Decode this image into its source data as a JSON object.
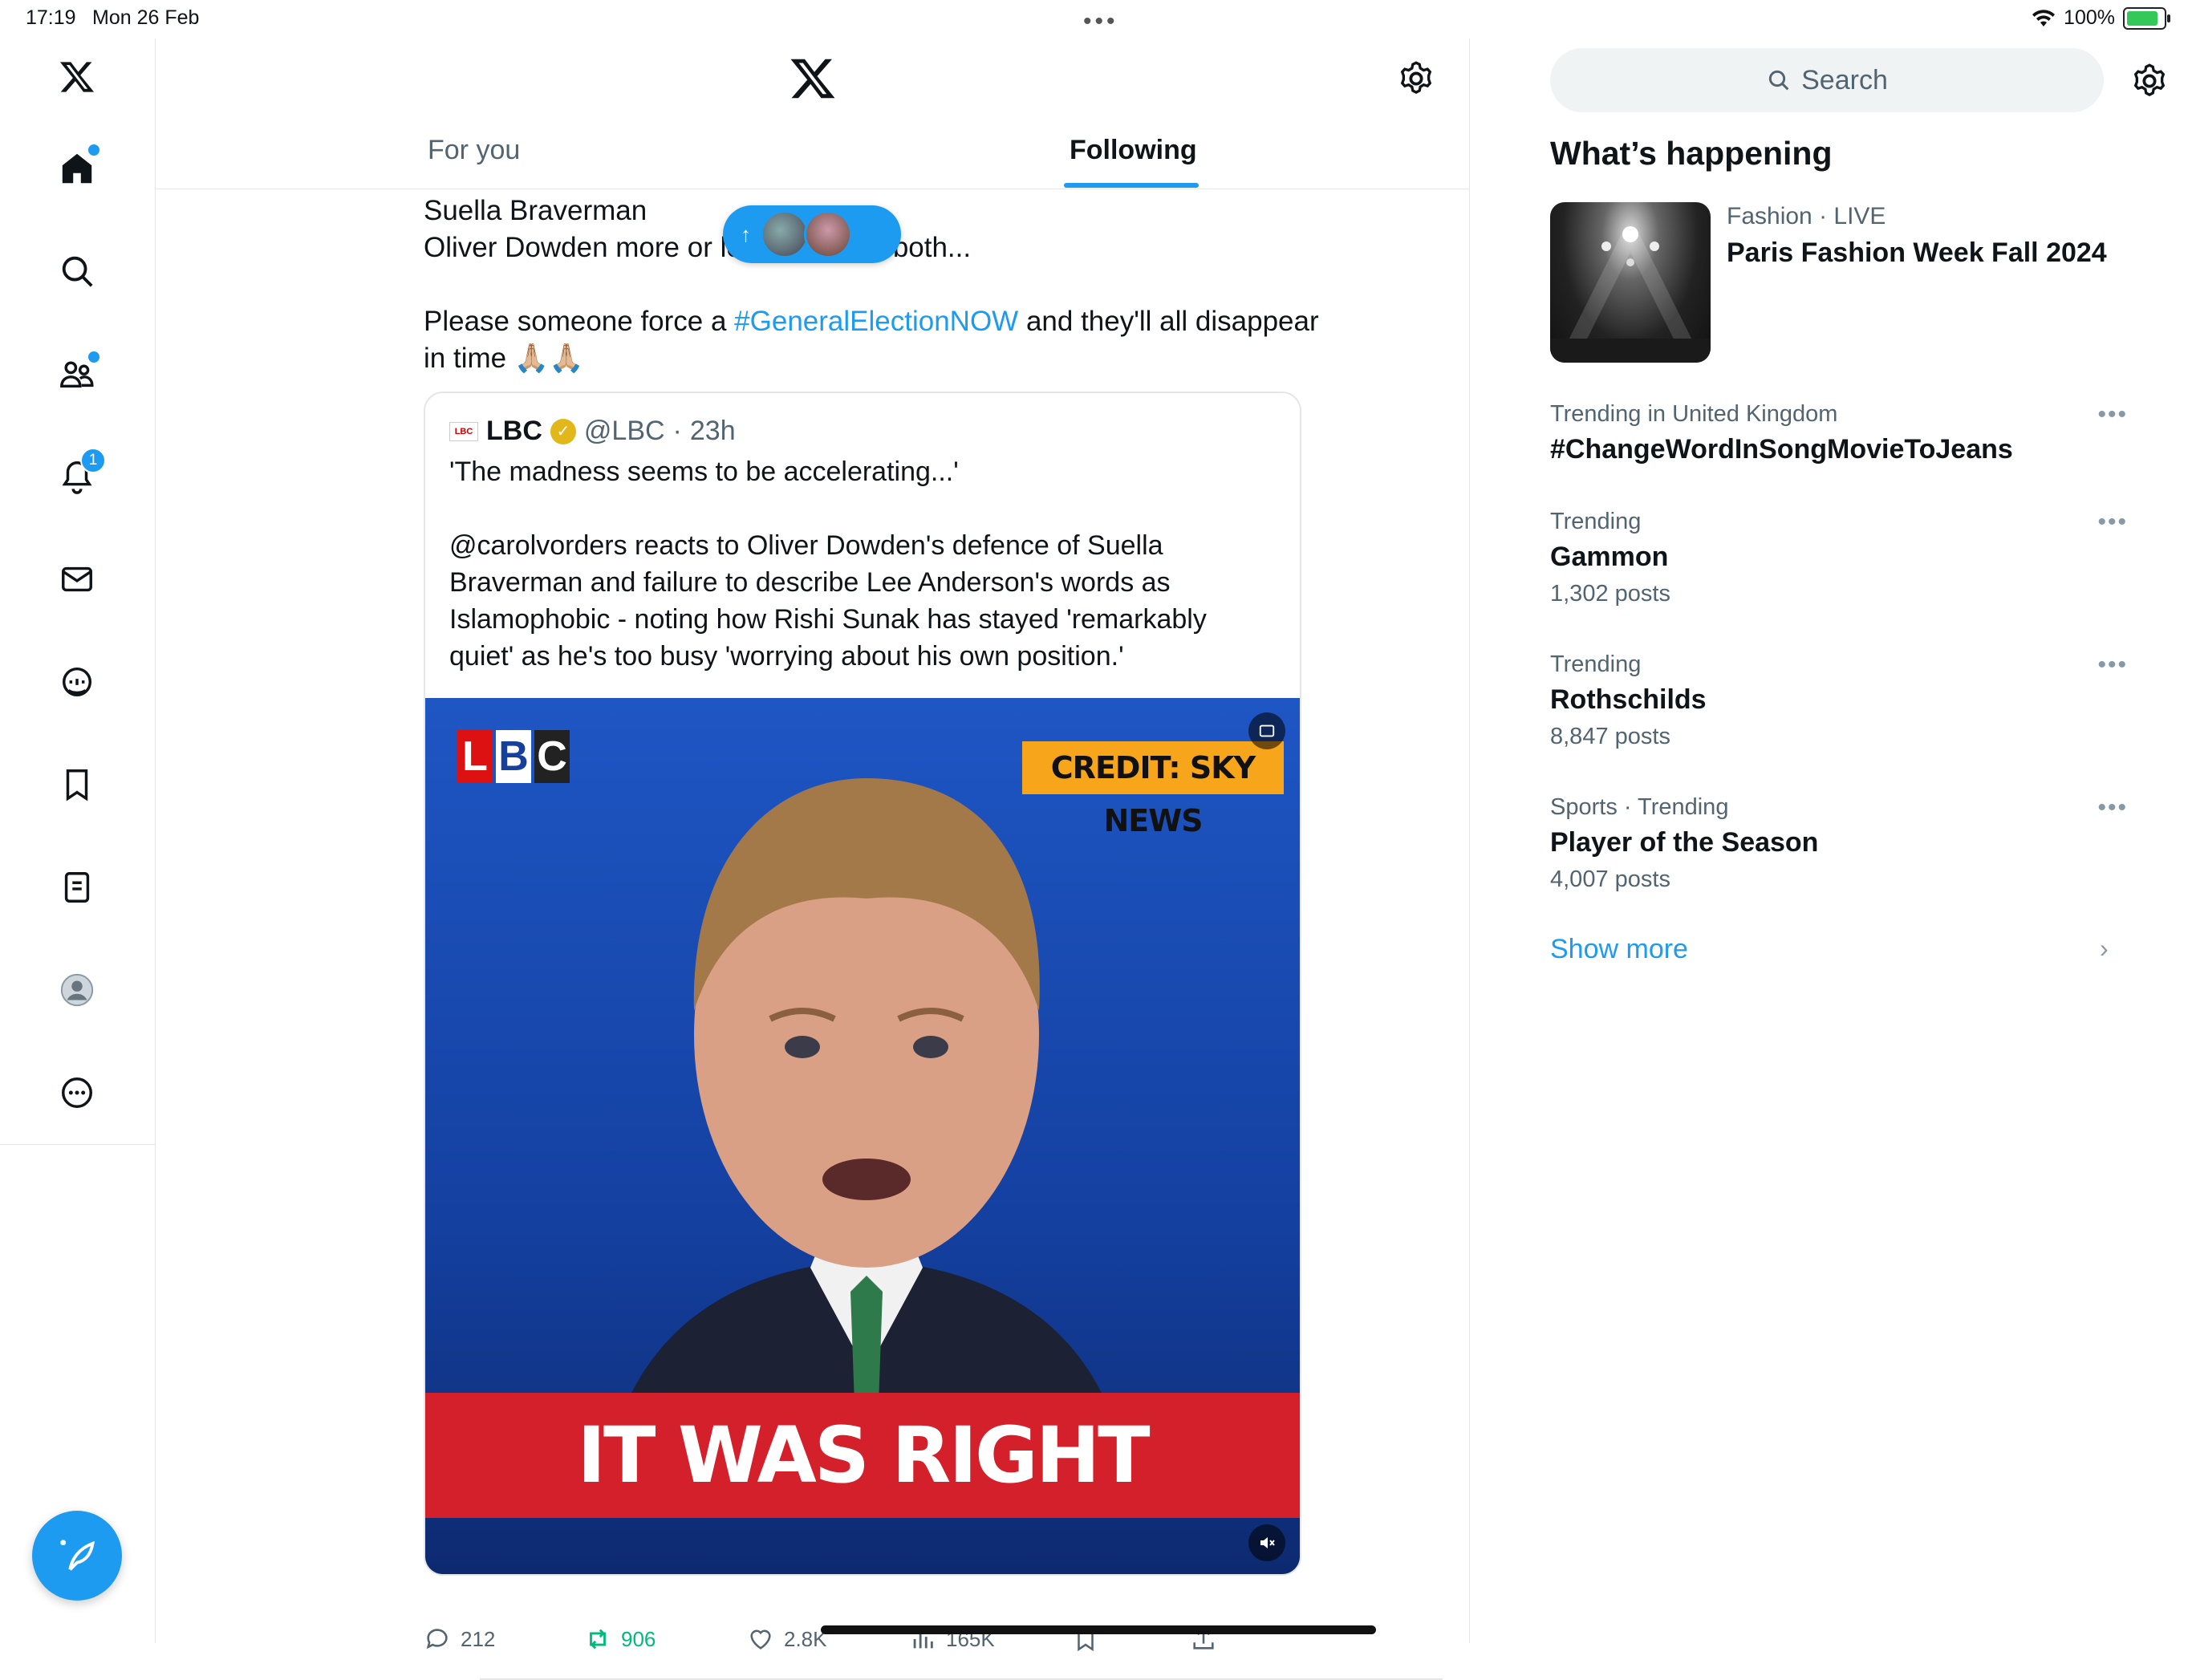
{
  "status_bar": {
    "time": "17:19",
    "date": "Mon 26 Feb",
    "battery": "100%"
  },
  "sidebar": {
    "items": [
      {
        "icon": "home-icon",
        "active": true
      },
      {
        "icon": "search-icon"
      },
      {
        "icon": "communities-icon"
      },
      {
        "icon": "notifications-icon",
        "badge": "1"
      },
      {
        "icon": "messages-icon"
      },
      {
        "icon": "grok-icon"
      },
      {
        "icon": "bookmarks-icon"
      },
      {
        "icon": "lists-icon"
      },
      {
        "icon": "profile-icon"
      },
      {
        "icon": "more-icon"
      }
    ],
    "compose_icon": "compose-icon"
  },
  "header": {
    "tabs": [
      {
        "label": "For you"
      },
      {
        "label": "Following"
      }
    ]
  },
  "tweet": {
    "line1": "Suella Braverman",
    "line2_a": "Oliver Dowden more or le",
    "line2_b": "both...",
    "line3_a": "Please someone force a ",
    "hashtag": "#GeneralElectionNOW",
    "line3_b": " and they'll all disappear",
    "line4": "in time 🙏🏼🙏🏼"
  },
  "new_posts_pill": {
    "arrow": "↑"
  },
  "quote": {
    "logo_text": "LBC",
    "name": "LBC",
    "handle": "@LBC",
    "sep": "·",
    "time": "23h",
    "text_1": "'The madness seems to be accelerating...'",
    "text_2": "@carolvorders reacts to Oliver Dowden's defence of Suella Braverman and failure to describe Lee Anderson's words as Islamophobic - noting how Rishi Sunak has stayed 'remarkably quiet' as he's too busy 'worrying about his own position.'",
    "video": {
      "logo_letters": [
        "L",
        "B",
        "C"
      ],
      "credit": "CREDIT: SKY NEWS",
      "banner": "IT WAS RIGHT"
    }
  },
  "actions": {
    "replies": "212",
    "reposts": "906",
    "likes": "2.8K",
    "views": "165K"
  },
  "right": {
    "search_placeholder": "Search",
    "whats_happening": "What’s happening",
    "fashion": {
      "category": "Fashion",
      "live": "LIVE",
      "sep": " · ",
      "title": "Paris Fashion Week Fall 2024"
    },
    "trends": [
      {
        "meta": "Trending in United Kingdom",
        "name": "#ChangeWordInSongMovieToJeans",
        "count": ""
      },
      {
        "meta": "Trending",
        "name": "Gammon",
        "count": "1,302 posts"
      },
      {
        "meta": "Trending",
        "name": "Rothschilds",
        "count": "8,847 posts"
      },
      {
        "meta": "Sports · Trending",
        "name": "Player of the Season",
        "count": "4,007 posts"
      }
    ],
    "show_more": "Show more"
  },
  "colors": {
    "accent": "#1d9bf0",
    "repost": "#00ba7c",
    "muted": "#536471"
  }
}
